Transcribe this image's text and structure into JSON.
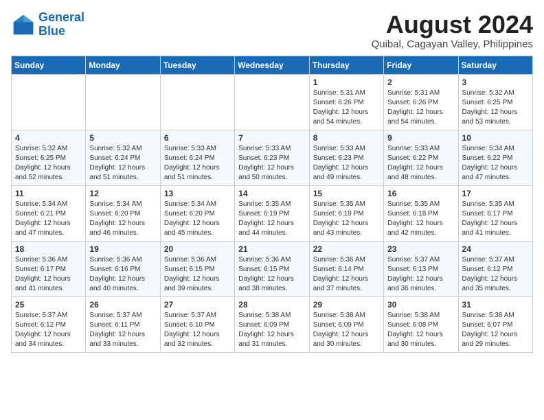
{
  "header": {
    "logo_line1": "General",
    "logo_line2": "Blue",
    "main_title": "August 2024",
    "subtitle": "Quibal, Cagayan Valley, Philippines"
  },
  "days_of_week": [
    "Sunday",
    "Monday",
    "Tuesday",
    "Wednesday",
    "Thursday",
    "Friday",
    "Saturday"
  ],
  "weeks": [
    [
      {
        "day": "",
        "info": ""
      },
      {
        "day": "",
        "info": ""
      },
      {
        "day": "",
        "info": ""
      },
      {
        "day": "",
        "info": ""
      },
      {
        "day": "1",
        "info": "Sunrise: 5:31 AM\nSunset: 6:26 PM\nDaylight: 12 hours\nand 54 minutes."
      },
      {
        "day": "2",
        "info": "Sunrise: 5:31 AM\nSunset: 6:26 PM\nDaylight: 12 hours\nand 54 minutes."
      },
      {
        "day": "3",
        "info": "Sunrise: 5:32 AM\nSunset: 6:25 PM\nDaylight: 12 hours\nand 53 minutes."
      }
    ],
    [
      {
        "day": "4",
        "info": "Sunrise: 5:32 AM\nSunset: 6:25 PM\nDaylight: 12 hours\nand 52 minutes."
      },
      {
        "day": "5",
        "info": "Sunrise: 5:32 AM\nSunset: 6:24 PM\nDaylight: 12 hours\nand 51 minutes."
      },
      {
        "day": "6",
        "info": "Sunrise: 5:33 AM\nSunset: 6:24 PM\nDaylight: 12 hours\nand 51 minutes."
      },
      {
        "day": "7",
        "info": "Sunrise: 5:33 AM\nSunset: 6:23 PM\nDaylight: 12 hours\nand 50 minutes."
      },
      {
        "day": "8",
        "info": "Sunrise: 5:33 AM\nSunset: 6:23 PM\nDaylight: 12 hours\nand 49 minutes."
      },
      {
        "day": "9",
        "info": "Sunrise: 5:33 AM\nSunset: 6:22 PM\nDaylight: 12 hours\nand 48 minutes."
      },
      {
        "day": "10",
        "info": "Sunrise: 5:34 AM\nSunset: 6:22 PM\nDaylight: 12 hours\nand 47 minutes."
      }
    ],
    [
      {
        "day": "11",
        "info": "Sunrise: 5:34 AM\nSunset: 6:21 PM\nDaylight: 12 hours\nand 47 minutes."
      },
      {
        "day": "12",
        "info": "Sunrise: 5:34 AM\nSunset: 6:20 PM\nDaylight: 12 hours\nand 46 minutes."
      },
      {
        "day": "13",
        "info": "Sunrise: 5:34 AM\nSunset: 6:20 PM\nDaylight: 12 hours\nand 45 minutes."
      },
      {
        "day": "14",
        "info": "Sunrise: 5:35 AM\nSunset: 6:19 PM\nDaylight: 12 hours\nand 44 minutes."
      },
      {
        "day": "15",
        "info": "Sunrise: 5:35 AM\nSunset: 6:19 PM\nDaylight: 12 hours\nand 43 minutes."
      },
      {
        "day": "16",
        "info": "Sunrise: 5:35 AM\nSunset: 6:18 PM\nDaylight: 12 hours\nand 42 minutes."
      },
      {
        "day": "17",
        "info": "Sunrise: 5:35 AM\nSunset: 6:17 PM\nDaylight: 12 hours\nand 41 minutes."
      }
    ],
    [
      {
        "day": "18",
        "info": "Sunrise: 5:36 AM\nSunset: 6:17 PM\nDaylight: 12 hours\nand 41 minutes."
      },
      {
        "day": "19",
        "info": "Sunrise: 5:36 AM\nSunset: 6:16 PM\nDaylight: 12 hours\nand 40 minutes."
      },
      {
        "day": "20",
        "info": "Sunrise: 5:36 AM\nSunset: 6:15 PM\nDaylight: 12 hours\nand 39 minutes."
      },
      {
        "day": "21",
        "info": "Sunrise: 5:36 AM\nSunset: 6:15 PM\nDaylight: 12 hours\nand 38 minutes."
      },
      {
        "day": "22",
        "info": "Sunrise: 5:36 AM\nSunset: 6:14 PM\nDaylight: 12 hours\nand 37 minutes."
      },
      {
        "day": "23",
        "info": "Sunrise: 5:37 AM\nSunset: 6:13 PM\nDaylight: 12 hours\nand 36 minutes."
      },
      {
        "day": "24",
        "info": "Sunrise: 5:37 AM\nSunset: 6:12 PM\nDaylight: 12 hours\nand 35 minutes."
      }
    ],
    [
      {
        "day": "25",
        "info": "Sunrise: 5:37 AM\nSunset: 6:12 PM\nDaylight: 12 hours\nand 34 minutes."
      },
      {
        "day": "26",
        "info": "Sunrise: 5:37 AM\nSunset: 6:11 PM\nDaylight: 12 hours\nand 33 minutes."
      },
      {
        "day": "27",
        "info": "Sunrise: 5:37 AM\nSunset: 6:10 PM\nDaylight: 12 hours\nand 32 minutes."
      },
      {
        "day": "28",
        "info": "Sunrise: 5:38 AM\nSunset: 6:09 PM\nDaylight: 12 hours\nand 31 minutes."
      },
      {
        "day": "29",
        "info": "Sunrise: 5:38 AM\nSunset: 6:09 PM\nDaylight: 12 hours\nand 30 minutes."
      },
      {
        "day": "30",
        "info": "Sunrise: 5:38 AM\nSunset: 6:08 PM\nDaylight: 12 hours\nand 30 minutes."
      },
      {
        "day": "31",
        "info": "Sunrise: 5:38 AM\nSunset: 6:07 PM\nDaylight: 12 hours\nand 29 minutes."
      }
    ]
  ]
}
